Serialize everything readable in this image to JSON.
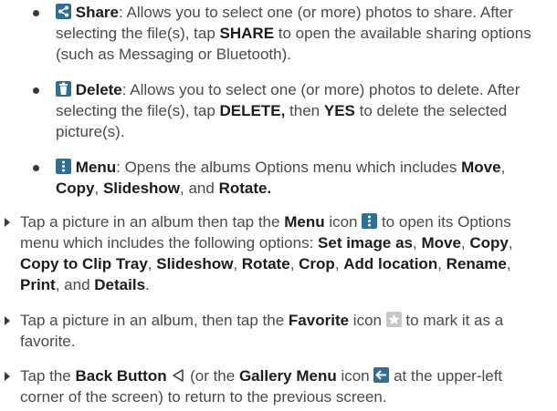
{
  "share": {
    "label": "Share",
    "text_a": ": Allows you to select one (or more) photos to share. After selecting the file(s), tap ",
    "keyword": "SHARE",
    "text_b": " to open the available sharing options (such as Messaging or Bluetooth)."
  },
  "delete": {
    "label": "Delete",
    "text_a": ": Allows you to select one (or more) photos to delete. After selecting the file(s), tap ",
    "keyword1": "DELETE,",
    "text_b": " then ",
    "keyword2": "YES",
    "text_c": " to delete the selected picture(s)."
  },
  "menu": {
    "label": "Menu",
    "text_a": ": Opens the albums Options menu which includes ",
    "opt1": "Move",
    "sep1": ", ",
    "opt2": "Copy",
    "sep2": ", ",
    "opt3": "Slideshow",
    "sep3": ", and ",
    "opt4": "Rotate."
  },
  "tap_menu": {
    "t1": "Tap a picture in an album then tap the ",
    "menu_word": "Menu",
    "t2": " icon ",
    "t3": " to open its Options menu which includes the following options: ",
    "o1": "Set image as",
    "s1": ", ",
    "o2": "Move",
    "s2": ", ",
    "o3": "Copy",
    "s3": ", ",
    "o4": "Copy to Clip Tray",
    "s4": ", ",
    "o5": "Slideshow",
    "s5": ", ",
    "o6": "Rotate",
    "s6": ", ",
    "o7": "Crop",
    "s7": ", ",
    "o8": "Add location",
    "s8": ", ",
    "o9": "Rename",
    "s9": ", ",
    "o10": "Print",
    "s10": ", and ",
    "o11": "Details",
    "end": "."
  },
  "tap_fav": {
    "t1": "Tap a picture in an album, then tap the ",
    "fav_word": "Favorite",
    "t2": " icon ",
    "t3": " to mark it as a favorite."
  },
  "tap_back": {
    "t1": "Tap the ",
    "back_word": "Back Button",
    "t2": " (or the ",
    "gallery_word": "Gallery Menu",
    "t3": " icon ",
    "t4": " at the upper-left corner of the screen) to return to the previous screen."
  },
  "colors": {
    "icon_blue": "#2f6f94",
    "star_gray": "#c7c7c7",
    "text": "#4a4a4a",
    "bold": "#1c1c1c"
  },
  "icons": [
    "share-icon",
    "trash-icon",
    "menu-icon",
    "favorite-star-icon",
    "back-triangle-icon",
    "gallery-back-arrow-icon"
  ]
}
